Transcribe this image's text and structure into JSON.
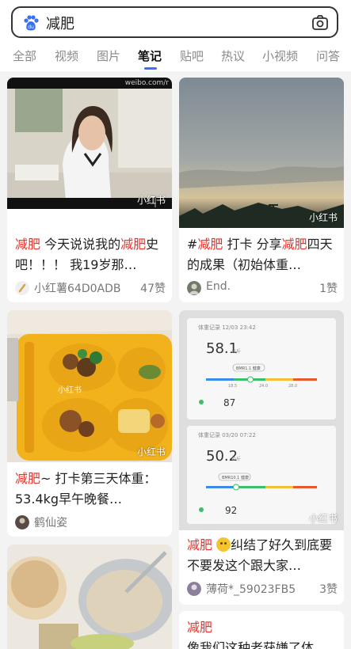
{
  "search": {
    "query": "减肥"
  },
  "tabs": [
    {
      "label": "全部"
    },
    {
      "label": "视频"
    },
    {
      "label": "图片"
    },
    {
      "label": "笔记"
    },
    {
      "label": "贴吧"
    },
    {
      "label": "热议"
    },
    {
      "label": "小视频"
    },
    {
      "label": "问答"
    }
  ],
  "active_tab": "笔记",
  "watermark": "小红书",
  "video_source": "weibo.com/r",
  "cards": [
    {
      "title_parts": [
        "减肥",
        " 今天说说我的",
        "减肥",
        "史吧！！！ 我19岁那…"
      ],
      "author": "小红薯64D0ADB",
      "likes": "47赞"
    },
    {
      "title_parts": [
        "#",
        "减肥",
        " 打卡 分享",
        "减肥",
        "四天的成果（初始体重…"
      ],
      "author": "End.",
      "likes": "1赞"
    },
    {
      "title_parts": [
        "减肥",
        "~ 打卡第三天体重：53.4kg早午晚餐…"
      ],
      "author": "鹤仙姿",
      "likes": ""
    },
    {
      "title_parts": [
        "减肥",
        " ",
        "纠结了好久到底要不要发这个跟大家…"
      ],
      "author": "薄荷*_59023FB5",
      "likes": "3赞"
    },
    {
      "title_parts": [
        "减肥",
        "像我们这种老获嫌了体质…"
      ],
      "author": "",
      "likes": ""
    }
  ],
  "scale_app": {
    "header1": "体重记录 12/03 23:42",
    "weight1": "58.1",
    "unit": "公斤",
    "bmr1": "BMR1.1 健康",
    "score1": "87",
    "header2": "体重记录 03/20 07:22",
    "weight2": "50.2",
    "bmr2": "BMR10.1 健康",
    "score2": "92",
    "ticks": [
      "18.5",
      "24.0",
      "28.0"
    ]
  },
  "colors": {
    "accent": "#3a71f2",
    "highlight": "#e8322a"
  }
}
